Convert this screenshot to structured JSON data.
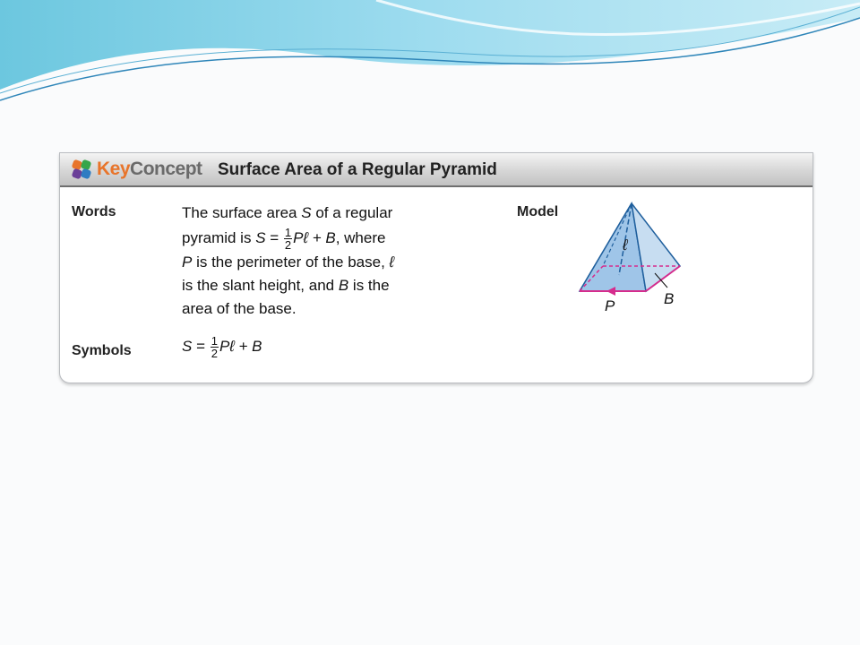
{
  "header": {
    "brand_key": "Key",
    "brand_concept": "Concept",
    "title": "Surface Area of a Regular Pyramid"
  },
  "words": {
    "label": "Words",
    "line1_a": "The surface area ",
    "line1_var": "S",
    "line1_b": " of a regular",
    "line2_a": "pyramid is ",
    "line2_b": ", where",
    "line3_var": "P",
    "line3_b": " is the perimeter of the base, ",
    "line3_ell": "ℓ",
    "line4_a": "is the slant height, and ",
    "line4_var": "B",
    "line4_b": " is the",
    "line5": "area of the base."
  },
  "formula": {
    "lhs": "S",
    "eq": " = ",
    "num": "1",
    "den": "2",
    "p_ell": "Pℓ",
    "rest": " + B"
  },
  "symbols": {
    "label": "Symbols"
  },
  "model": {
    "label": "Model",
    "ell_label": "ℓ",
    "p_label": "P",
    "b_label": "B"
  },
  "colors": {
    "accent": "#e8742a",
    "magenta": "#d62c8d",
    "pyramid_face": "#a9cbe8",
    "pyramid_edge": "#1f5f9d"
  }
}
